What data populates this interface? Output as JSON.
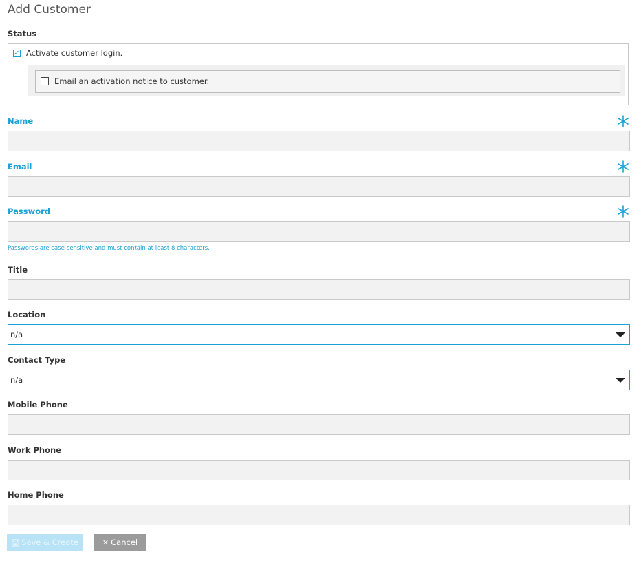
{
  "page": {
    "title": "Add Customer"
  },
  "status": {
    "label": "Status",
    "activate_login": {
      "label": "Activate customer login.",
      "checked": true
    },
    "email_notice": {
      "label": "Email an activation notice to customer.",
      "checked": false
    }
  },
  "fields": {
    "name": {
      "label": "Name",
      "value": "",
      "required": true
    },
    "email": {
      "label": "Email",
      "value": "",
      "required": true
    },
    "password": {
      "label": "Password",
      "value": "",
      "required": true,
      "hint": "Passwords are case-sensitive and must contain at least 8 characters."
    },
    "title": {
      "label": "Title",
      "value": ""
    },
    "location": {
      "label": "Location",
      "selected": "n/a"
    },
    "contact_type": {
      "label": "Contact Type",
      "selected": "n/a"
    },
    "mobile_phone": {
      "label": "Mobile Phone",
      "value": ""
    },
    "work_phone": {
      "label": "Work Phone",
      "value": ""
    },
    "home_phone": {
      "label": "Home Phone",
      "value": ""
    }
  },
  "buttons": {
    "save": {
      "label": "Save & Create",
      "icon": "save-icon",
      "disabled": true
    },
    "cancel": {
      "label": "Cancel",
      "icon": "close-icon"
    }
  },
  "colors": {
    "accent": "#1ba1d6",
    "field_bg": "#f2f2f2",
    "cancel_bg": "#9b9b9b",
    "save_disabled_bg": "#b8e3f6"
  }
}
